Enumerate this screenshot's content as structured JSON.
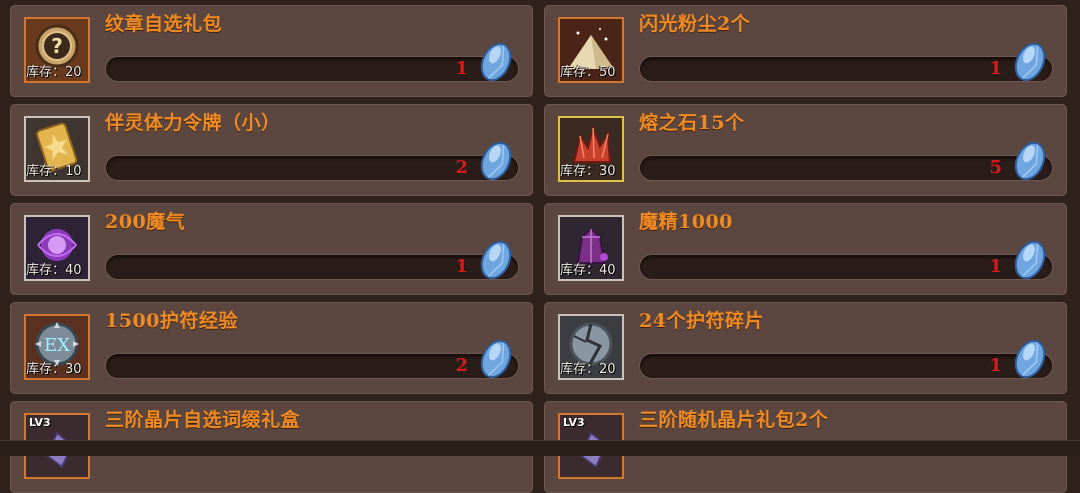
{
  "items": [
    {
      "title": "纹章自选礼包",
      "stock": "库存：20",
      "count": "1",
      "icon": "badge-question-icon",
      "frame": "orange"
    },
    {
      "title": "闪光粉尘2个",
      "stock": "库存：50",
      "count": "1",
      "icon": "sparkle-dust-icon",
      "frame": "orange"
    },
    {
      "title": "伴灵体力令牌（小）",
      "stock": "库存：10",
      "count": "2",
      "icon": "stamina-token-icon",
      "frame": "silver"
    },
    {
      "title": "熔之石15个",
      "stock": "库存：30",
      "count": "5",
      "icon": "lava-stone-icon",
      "frame": "gold"
    },
    {
      "title": "200魔气",
      "stock": "库存：40",
      "count": "1",
      "icon": "magic-energy-icon",
      "frame": "silver"
    },
    {
      "title": "魔精1000",
      "stock": "库存：40",
      "count": "1",
      "icon": "magic-essence-icon",
      "frame": "silver"
    },
    {
      "title": "1500护符经验",
      "stock": "库存：30",
      "count": "2",
      "icon": "ex-amulet-icon",
      "frame": "orange"
    },
    {
      "title": "24个护符碎片",
      "stock": "库存：20",
      "count": "1",
      "icon": "amulet-fragment-icon",
      "frame": "silver"
    },
    {
      "title": "三阶晶片自选词缀礼盒",
      "stock": "",
      "count": "",
      "icon": "crystal-box-icon",
      "frame": "orange",
      "level": "LV3"
    },
    {
      "title": "三阶随机晶片礼包2个",
      "stock": "",
      "count": "",
      "icon": "crystal-box-icon",
      "frame": "orange",
      "level": "LV3"
    }
  ],
  "colors": {
    "title": "#f08a22",
    "count": "#d81a1a",
    "card": "#5c4740",
    "gem": "#7fb2e6"
  }
}
